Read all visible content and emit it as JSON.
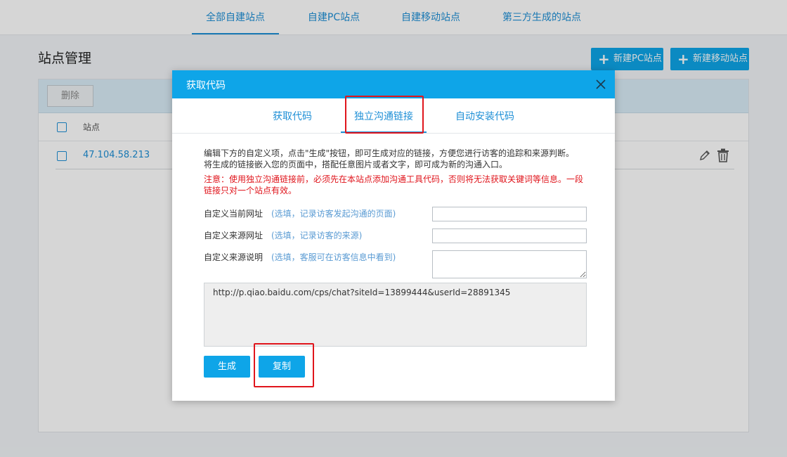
{
  "topnav": {
    "tabs": [
      {
        "label": "全部自建站点",
        "active": true
      },
      {
        "label": "自建PC站点",
        "active": false
      },
      {
        "label": "自建移动站点",
        "active": false
      },
      {
        "label": "第三方生成的站点",
        "active": false
      }
    ]
  },
  "page": {
    "title": "站点管理",
    "new_pc_label": "新建PC站点",
    "new_mobile_label": "新建移动站点",
    "delete_label": "删除",
    "column_site": "站点",
    "rows": [
      {
        "site": "47.104.58.213"
      }
    ]
  },
  "modal": {
    "title": "获取代码",
    "tabs": [
      {
        "label": "获取代码",
        "active": false
      },
      {
        "label": "独立沟通链接",
        "active": true
      },
      {
        "label": "自动安装代码",
        "active": false
      }
    ],
    "description_line1": "编辑下方的自定义项，点击\"生成\"按钮，即可生成对应的链接，方便您进行访客的追踪和来源判断。",
    "description_line2": "将生成的链接嵌入您的页面中，搭配任意图片或者文字，即可成为新的沟通入口。",
    "warning": "注意：使用独立沟通链接前，必须先在本站点添加沟通工具代码，否则将无法获取关键词等信息。一段链接只对一个站点有效。",
    "fields": [
      {
        "label": "自定义当前网址",
        "hint": "(选填，记录访客发起沟通的页面)",
        "value": ""
      },
      {
        "label": "自定义来源网址",
        "hint": "(选填，记录访客的来源)",
        "value": ""
      },
      {
        "label": "自定义来源说明",
        "hint": "(选填，客服可在访客信息中看到)",
        "value": ""
      }
    ],
    "generated_link": "http://p.qiao.baidu.com/cps/chat?siteId=13899444&userId=28891345",
    "generate_label": "生成",
    "copy_label": "复制"
  },
  "colors": {
    "accent": "#0ea5e8",
    "link": "#1e8fd6",
    "warning": "#e0151c",
    "highlight": "#e0151c"
  }
}
